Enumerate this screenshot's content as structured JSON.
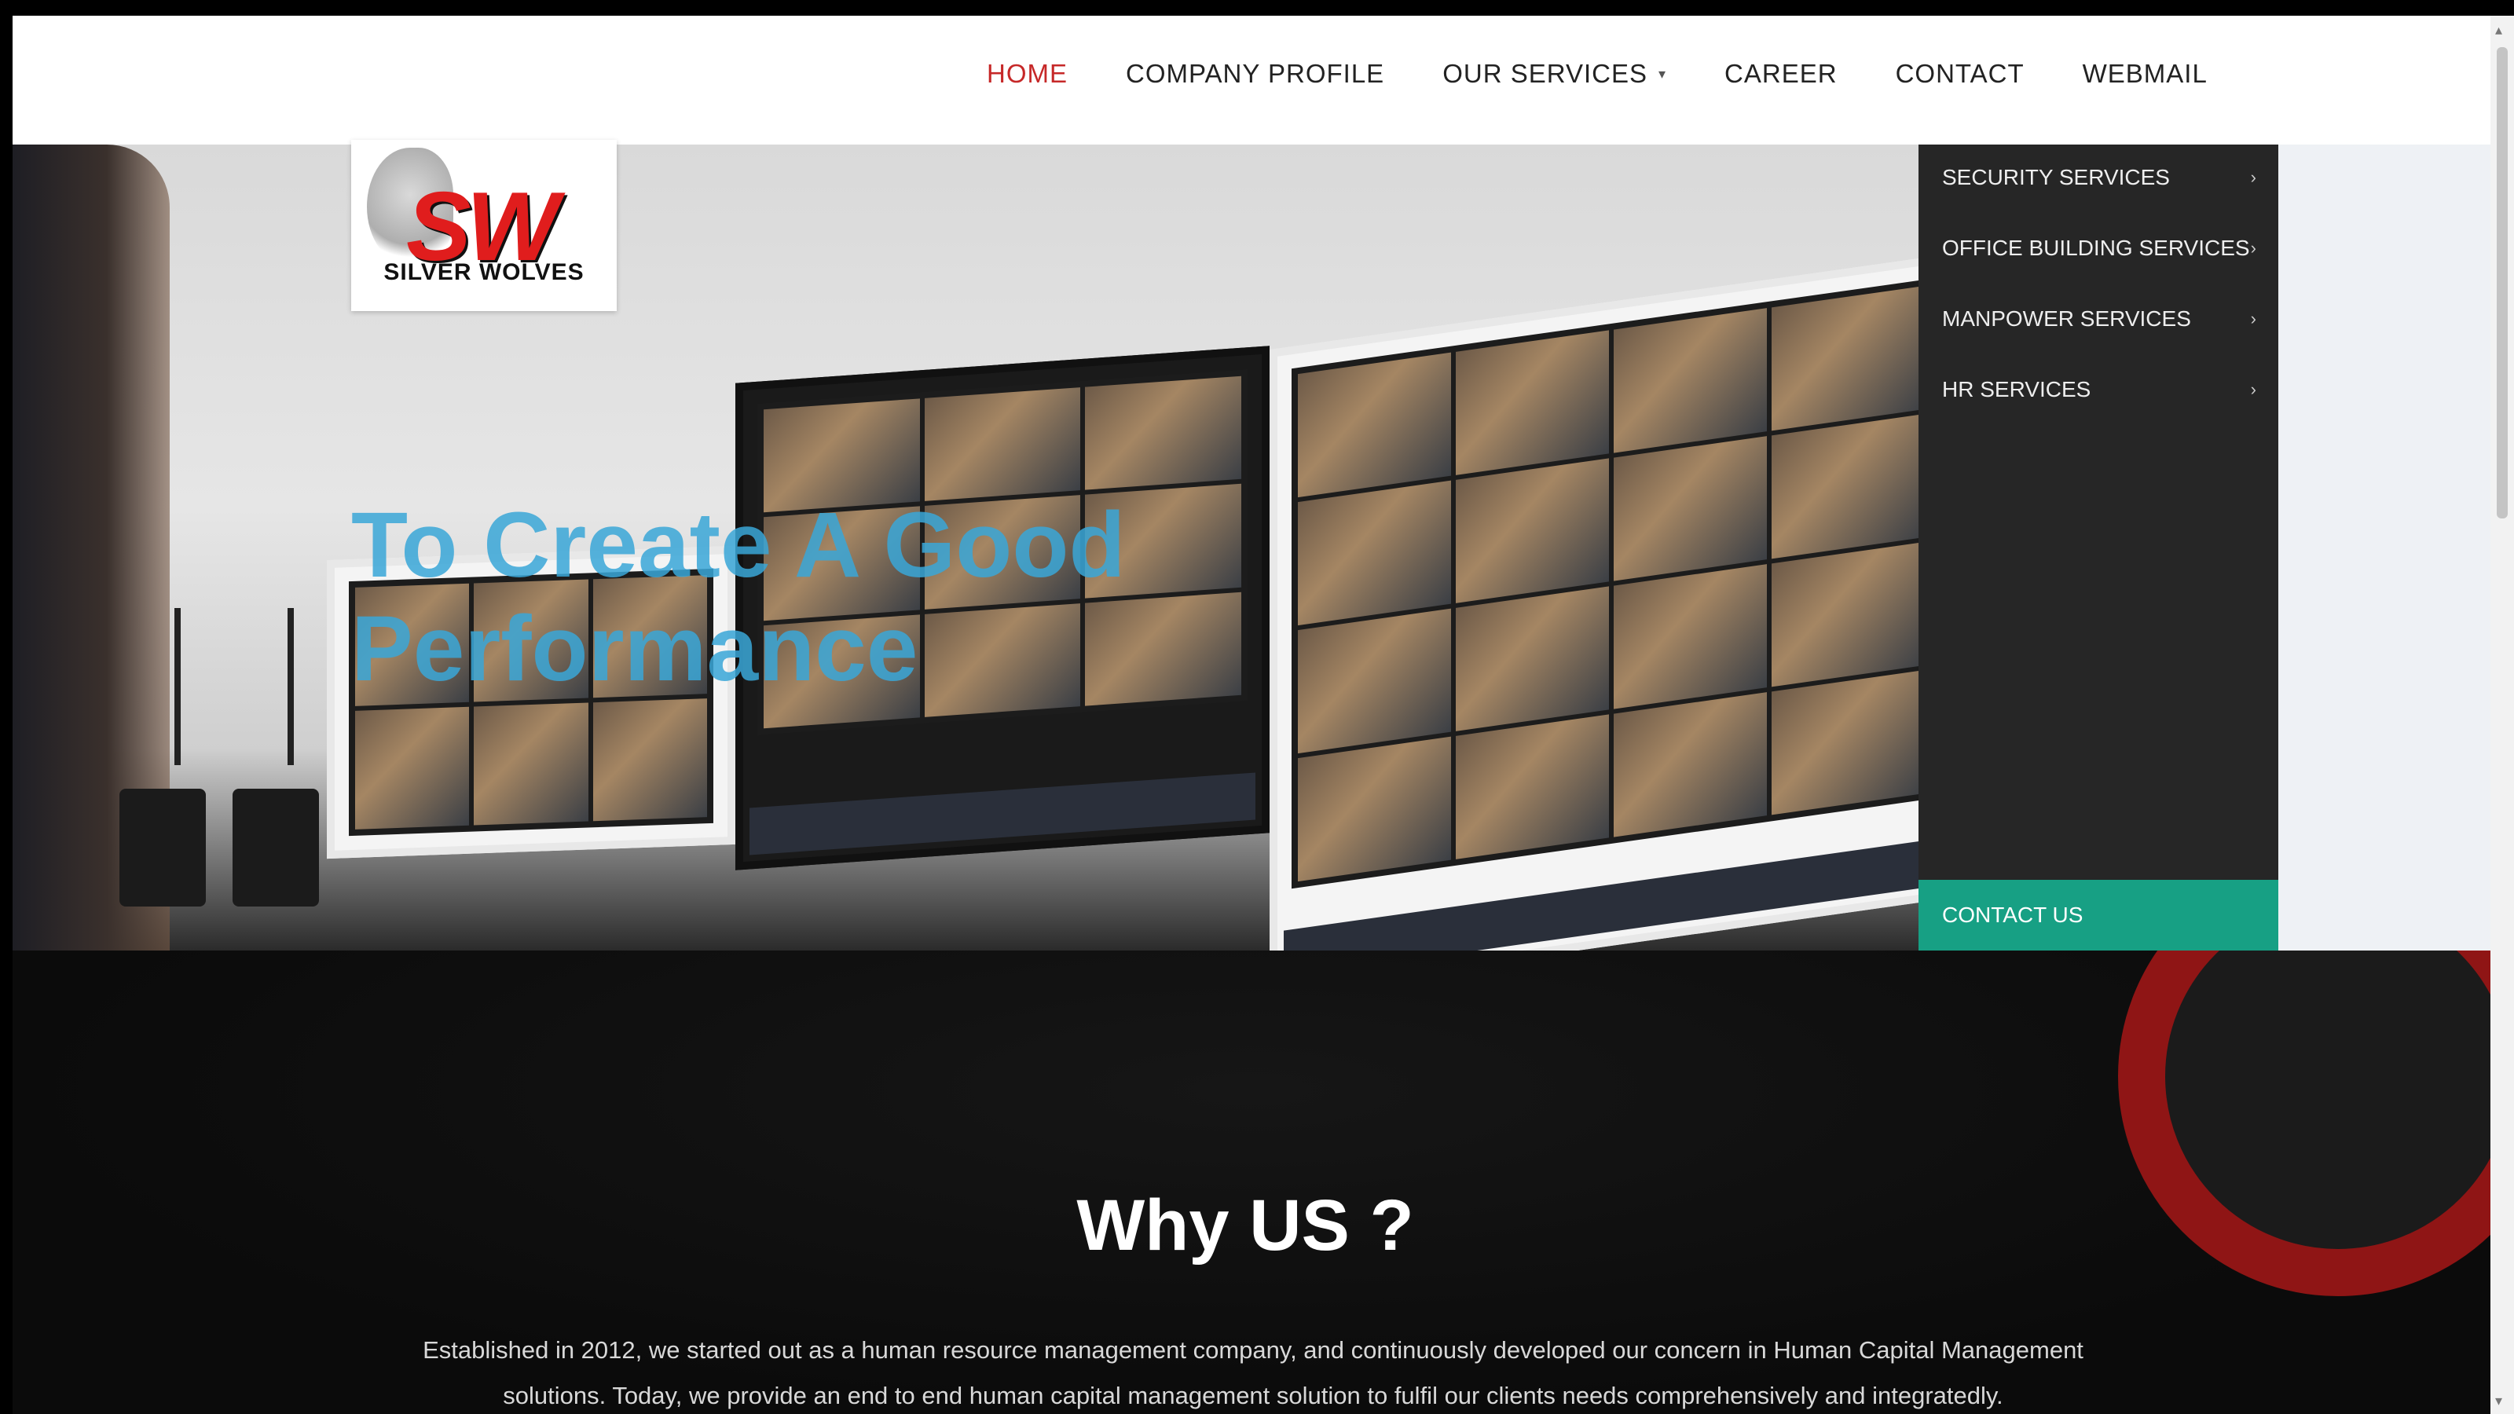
{
  "nav": {
    "items": [
      {
        "label": "HOME",
        "active": true
      },
      {
        "label": "COMPANY PROFILE"
      },
      {
        "label": "OUR SERVICES",
        "has_dropdown": true
      },
      {
        "label": "CAREER"
      },
      {
        "label": "CONTACT"
      },
      {
        "label": "WEBMAIL"
      }
    ]
  },
  "logo": {
    "mark": "SW",
    "name": "SILVER WOLVES"
  },
  "hero": {
    "title": "To Create A Good Performance"
  },
  "dropdown": {
    "items": [
      {
        "label": "SECURITY SERVICES"
      },
      {
        "label": "OFFICE BUILDING SERVICES"
      },
      {
        "label": "MANPOWER SERVICES"
      },
      {
        "label": "HR SERVICES"
      }
    ],
    "contact_label": "CONTACT US"
  },
  "why": {
    "title": "Why US ?",
    "text": "Established in 2012, we started out as a human resource management company, and continuously developed our concern in Human Capital Management solutions. Today, we provide an end to end human capital management solution to fulfil our clients needs comprehensively and integratedly."
  },
  "colors": {
    "accent_red": "#c62828",
    "logo_red": "#e01d1d",
    "hero_title": "#3aa7d8",
    "dropdown_bg": "#262626",
    "contact_green": "#17a084"
  }
}
